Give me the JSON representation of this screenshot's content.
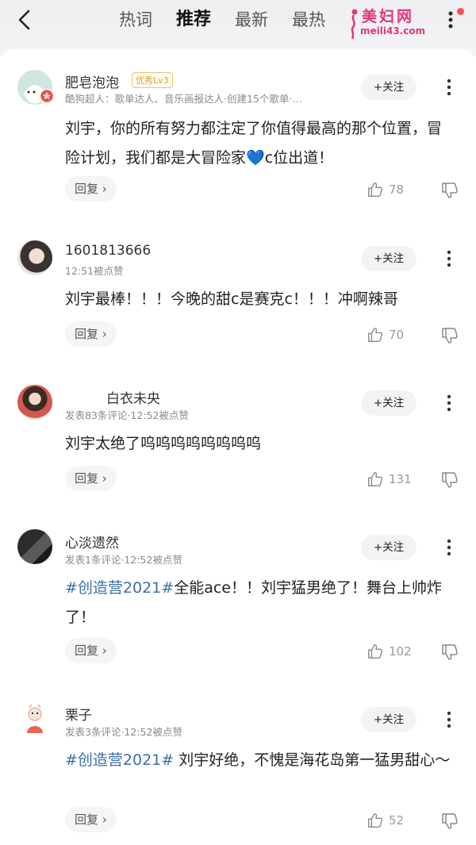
{
  "nav": {
    "tabs": [
      {
        "label": "热词"
      },
      {
        "label": "推荐"
      },
      {
        "label": "最新"
      },
      {
        "label": "最热"
      }
    ],
    "active_tab": "推荐"
  },
  "watermark": {
    "text": "美妇网",
    "url": "meili43.com"
  },
  "comments": [
    {
      "username": "肥皂泡泡",
      "badge": "优秀Lv3",
      "meta": "酷狗超人：歌单达人、音乐画报达人·创建15个歌单·…",
      "follow": "+关注",
      "content_before": "刘宇，你的所有努力都注定了你值得最高的那个位置，冒险计划，我们都是大冒险家",
      "heart": "💙",
      "content_after": "c位出道！",
      "reply": "回复 ›",
      "likes": "78"
    },
    {
      "username": "1601813666",
      "meta": "12:51被点赞",
      "follow": "+关注",
      "content": "刘宇最棒！！！今晚的甜c是赛克c！！！冲啊辣哥",
      "reply": "回复 ›",
      "likes": "70"
    },
    {
      "username": "白衣未央",
      "meta": "发表83条评论·12:52被点赞",
      "follow": "+关注",
      "content": "刘宇太绝了呜呜呜呜呜呜呜呜",
      "reply": "回复 ›",
      "likes": "131"
    },
    {
      "username": "心淡遗然",
      "meta": "发表1条评论·12:52被点赞",
      "follow": "+关注",
      "hashtag": "#创造营2021#",
      "content": "全能ace！！刘宇猛男绝了！舞台上帅炸了！",
      "reply": "回复 ›",
      "likes": "102"
    },
    {
      "username": "栗子",
      "meta": "发表3条评论·12:52被点赞",
      "follow": "+关注",
      "hashtag": "#创造营2021#",
      "content": " 刘宇好绝，不愧是海花岛第一猛男甜心～",
      "reply": "回复 ›",
      "likes": "52"
    }
  ],
  "colors": {
    "hashtag": "#3b6ea8",
    "watermark": "#e0357d",
    "notification_dot": "#ff4d4f"
  }
}
